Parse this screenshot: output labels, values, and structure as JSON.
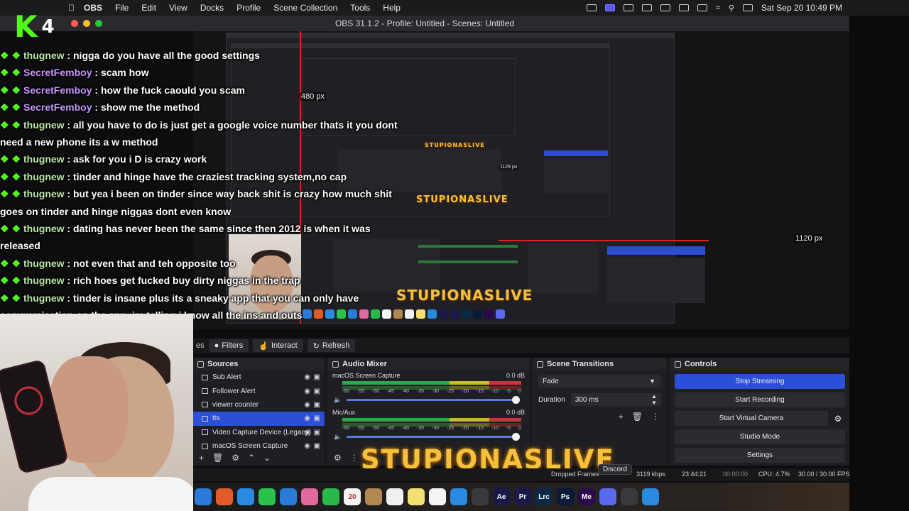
{
  "menubar": {
    "app_name": "OBS",
    "items": [
      "File",
      "Edit",
      "View",
      "Docks",
      "Profile",
      "Scene Collection",
      "Tools",
      "Help"
    ],
    "clock": "Sat Sep 20  10:49 PM"
  },
  "window": {
    "title": "OBS 31.1.2 - Profile: Untitled - Scenes: Untitled"
  },
  "overlay": {
    "logo_k": "K",
    "logo_number": "4",
    "chat": [
      {
        "user": "thugnew",
        "message": "nigga do you have all the good settings",
        "color": "green"
      },
      {
        "user": "SecretFemboy",
        "message": "scam how",
        "color": "pink"
      },
      {
        "user": "SecretFemboy",
        "message": "how the fuck caould you scam",
        "color": "pink"
      },
      {
        "user": "SecretFemboy",
        "message": "show me the method",
        "color": "pink"
      },
      {
        "user": "thugnew",
        "message": "all you have to do is just get a google voice number thats it you dont need a new phone its a w method",
        "color": "green"
      },
      {
        "user": "thugnew",
        "message": "ask for you i D is crazy work",
        "color": "green"
      },
      {
        "user": "thugnew",
        "message": "tinder and hinge have the craziest tracking system,no cap",
        "color": "green"
      },
      {
        "user": "thugnew",
        "message": "but yea i been on tinder since way back shit is crazy how much shit goes on tinder and hinge niggas dont even know",
        "color": "green"
      },
      {
        "user": "thugnew",
        "message": "dating has never been the same since then 2012 is when it was released",
        "color": "green"
      },
      {
        "user": "thugnew",
        "message": "not even that and teh opposite too",
        "color": "green"
      },
      {
        "user": "thugnew",
        "message": "rich hoes get fucked buy dirty niggas in the trap",
        "color": "green"
      },
      {
        "user": "thugnew",
        "message": "tinder is insane plus its a sneaky app that you can only have communication on the app, im telling i know all the ins and outs",
        "color": "green"
      }
    ],
    "brand": "STUPIONASLIVE",
    "size_480": "480 px",
    "size_1120": "1120 px",
    "size_1129": "1129 px"
  },
  "toolbar": {
    "filters": "Filters",
    "interact": "Interact",
    "refresh": "Refresh",
    "partial": "es"
  },
  "sources": {
    "title": "Sources",
    "items": [
      {
        "name": "Sub Alert",
        "selected": false
      },
      {
        "name": "Follower Alert",
        "selected": false
      },
      {
        "name": "viewer counter",
        "selected": false
      },
      {
        "name": "tts",
        "selected": true
      },
      {
        "name": "Video Capture Device (Legacy)",
        "selected": false
      },
      {
        "name": "macOS Screen Capture",
        "selected": false
      }
    ]
  },
  "mixer": {
    "title": "Audio Mixer",
    "channels": [
      {
        "name": "macOS Screen Capture",
        "db": "0.0 dB"
      },
      {
        "name": "Mic/Aux",
        "db": "0.0 dB"
      }
    ],
    "ticks": [
      "-60",
      "-55",
      "-50",
      "-45",
      "-40",
      "-35",
      "-30",
      "-25",
      "-20",
      "-15",
      "-10",
      "-5",
      "0"
    ]
  },
  "transitions": {
    "title": "Scene Transitions",
    "selected": "Fade",
    "duration_label": "Duration",
    "duration_value": "300 ms"
  },
  "controls": {
    "title": "Controls",
    "stop_streaming": "Stop Streaming",
    "start_recording": "Start Recording",
    "start_virtual_camera": "Start Virtual Camera",
    "studio_mode": "Studio Mode",
    "settings": "Settings"
  },
  "status": {
    "dropped_frames": "Dropped Frames",
    "tooltip": "Discord",
    "kbps": "3119 kbps",
    "live_time": "23:44:21",
    "rec_time": "00:00:00",
    "cpu": "CPU: 4.7%",
    "fps": "30.00 / 30.00 FPS"
  },
  "dock": {
    "apps": [
      {
        "label": "",
        "color": "#2a7ad8"
      },
      {
        "label": "",
        "color": "#e05a2a"
      },
      {
        "label": "",
        "color": "#2a8ae0"
      },
      {
        "label": "",
        "color": "#2ac24a"
      },
      {
        "label": "",
        "color": "#2a7ad8"
      },
      {
        "label": "",
        "color": "#e06aa0"
      },
      {
        "label": "",
        "color": "#2ab84a"
      },
      {
        "label": "20",
        "color": "#f4f4f4"
      },
      {
        "label": "",
        "color": "#b08850"
      },
      {
        "label": "",
        "color": "#f0f0f0"
      },
      {
        "label": "",
        "color": "#f4e070"
      },
      {
        "label": "",
        "color": "#f4f4f4"
      },
      {
        "label": "",
        "color": "#2a8ae0"
      },
      {
        "label": "",
        "color": "#3a3a3e"
      },
      {
        "label": "Ae",
        "color": "#1a1a4a"
      },
      {
        "label": "Pr",
        "color": "#1a1a4a"
      },
      {
        "label": "Lrc",
        "color": "#0a2a4a"
      },
      {
        "label": "Ps",
        "color": "#0a1a3a"
      },
      {
        "label": "Me",
        "color": "#2a0a4a"
      },
      {
        "label": "",
        "color": "#5a6af0"
      },
      {
        "label": "",
        "color": "#3a3a3e"
      },
      {
        "label": "",
        "color": "#2a8ae0"
      }
    ]
  },
  "colors": {
    "kick_green": "#53fc18",
    "accent_blue": "#2c4fd8"
  }
}
